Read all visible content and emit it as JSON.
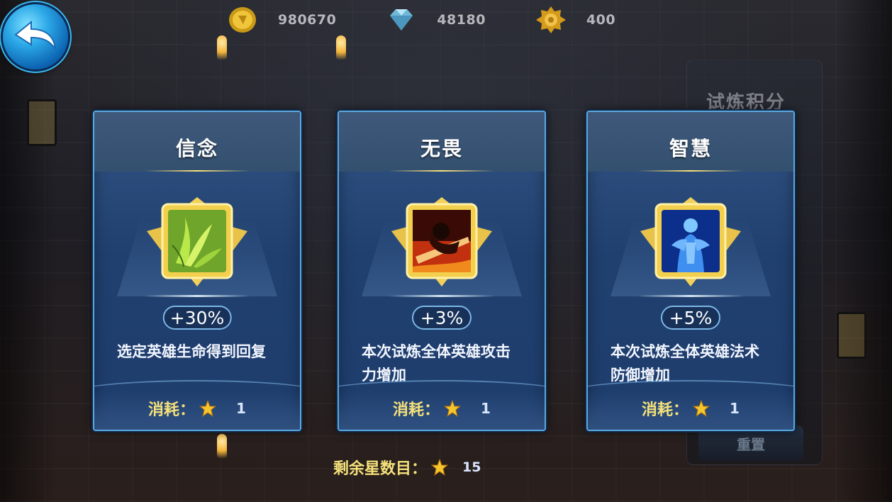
{
  "resources": [
    {
      "icon": "gold-coin-icon",
      "value": "980670"
    },
    {
      "icon": "diamond-icon",
      "value": "48180"
    },
    {
      "icon": "gold-medal-icon",
      "value": "400"
    }
  ],
  "back_button": {
    "icon": "back-arrow-icon"
  },
  "right_panel": {
    "title": "试炼积分",
    "reset_label": "重置"
  },
  "cards": [
    {
      "title": "信念",
      "bonus": "+30%",
      "description": "选定英雄生命得到回复",
      "cost_label": "消耗：",
      "cost_value": "1",
      "icon": "green-leaves-icon"
    },
    {
      "title": "无畏",
      "bonus": "+3%",
      "description": "本次试炼全体英雄攻击力增加",
      "cost_label": "消耗：",
      "cost_value": "1",
      "icon": "fiery-warrior-icon"
    },
    {
      "title": "智慧",
      "bonus": "+5%",
      "description": "本次试炼全体英雄法术防御增加",
      "cost_label": "消耗：",
      "cost_value": "1",
      "icon": "blue-spirit-icon"
    }
  ],
  "remaining": {
    "label": "剩余星数目：",
    "value": "15"
  },
  "colors": {
    "accent_gold": "#f5e17a",
    "card_blue": "#20406f",
    "border_blue": "#5aa9df"
  }
}
